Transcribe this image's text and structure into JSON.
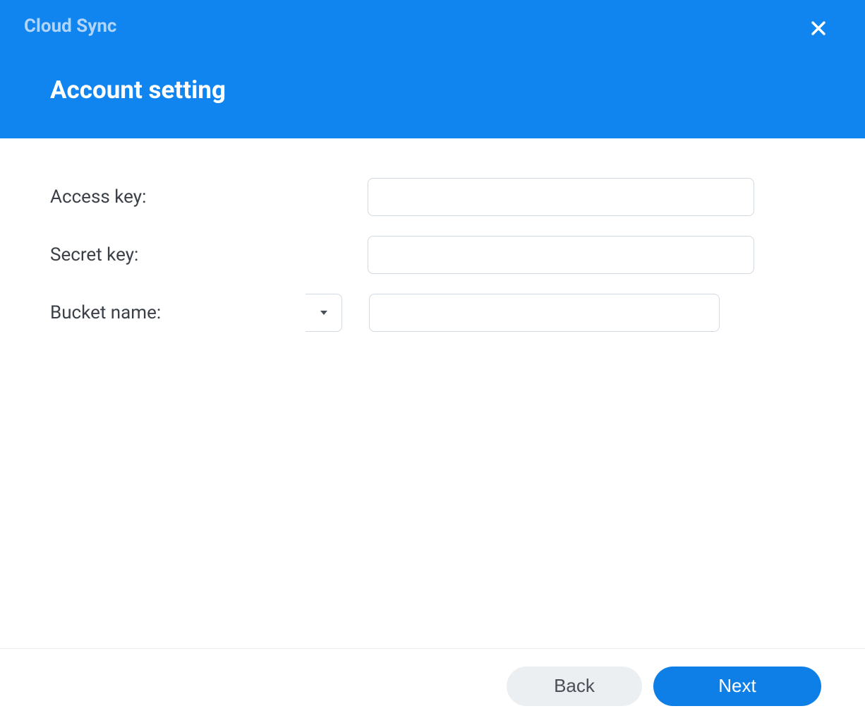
{
  "header": {
    "app_title": "Cloud Sync",
    "page_title": "Account setting"
  },
  "form": {
    "access_key": {
      "label": "Access key:",
      "value": ""
    },
    "secret_key": {
      "label": "Secret key:",
      "value": ""
    },
    "bucket_name": {
      "label": "Bucket name:",
      "value": "",
      "dropdown_value": ""
    }
  },
  "footer": {
    "back_label": "Back",
    "next_label": "Next"
  }
}
